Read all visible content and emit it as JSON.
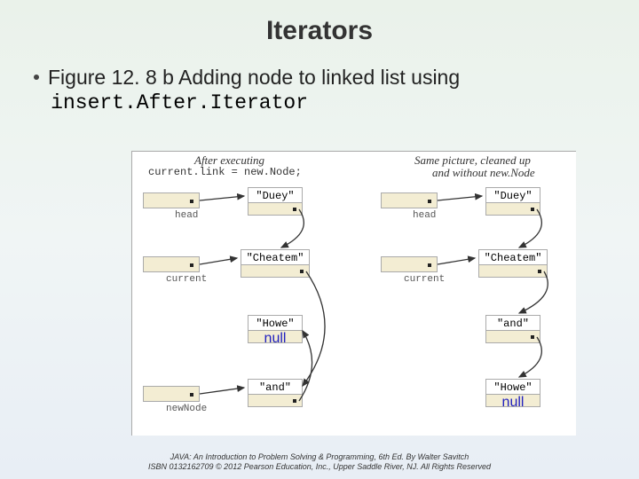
{
  "title": "Iterators",
  "bullet": {
    "prefix": "Figure 12. 8 b Adding node to linked list using ",
    "code": "insert.After.Iterator"
  },
  "figure": {
    "left_caption_1": "After executing",
    "left_caption_2": "current.link = new.Node;",
    "right_caption_1": "Same picture, cleaned up",
    "right_caption_2": "and without new.Node",
    "labels": {
      "head": "head",
      "current": "current",
      "newNode": "newNode"
    },
    "nodes": {
      "duey": "\"Duey\"",
      "cheatem": "\"Cheatem\"",
      "howe": "\"Howe\"",
      "and": "\"and\"",
      "null": "null"
    }
  },
  "footer": {
    "line1": "JAVA: An Introduction to Problem Solving & Programming, 6th Ed. By Walter Savitch",
    "line2": "ISBN 0132162709 © 2012 Pearson Education, Inc., Upper Saddle River, NJ. All Rights Reserved"
  }
}
